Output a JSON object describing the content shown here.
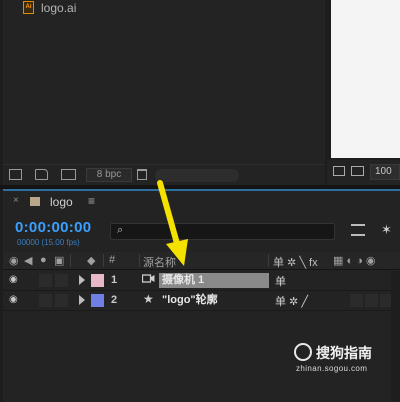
{
  "project": {
    "file_name": "logo.ai",
    "file_icon_text": "Ai",
    "bit_depth": "8 bpc"
  },
  "viewer": {
    "zoom": "100"
  },
  "timeline": {
    "tab": {
      "close": "×",
      "comp_name": "logo",
      "menu": "≡"
    },
    "timecode": "0:00:00:00",
    "fps_label": "00000 (15.00 fps)",
    "search_icon": "⌕",
    "columns": {
      "num": "#",
      "source_name": "源名称",
      "switches_glyphs": "单 ✲ ╲ fx"
    },
    "layers": [
      {
        "num": "1",
        "type_icon": "camera-icon",
        "type_glyph": "▶",
        "name": "摄像机 1",
        "label_color": "#e7b9c6",
        "switches": "单"
      },
      {
        "num": "2",
        "type_icon": "star-icon",
        "type_glyph": "★",
        "name": "\"logo\"轮廓",
        "label_color": "#6f7fe4",
        "switches": "单 ✲ ╱"
      }
    ]
  },
  "watermark": {
    "title": "搜狗指南",
    "url": "zhinan.sogou.com"
  },
  "colors": {
    "timecode": "#3aa0ff",
    "accent_border": "#2f6f9f",
    "arrow": "#f5e100"
  }
}
